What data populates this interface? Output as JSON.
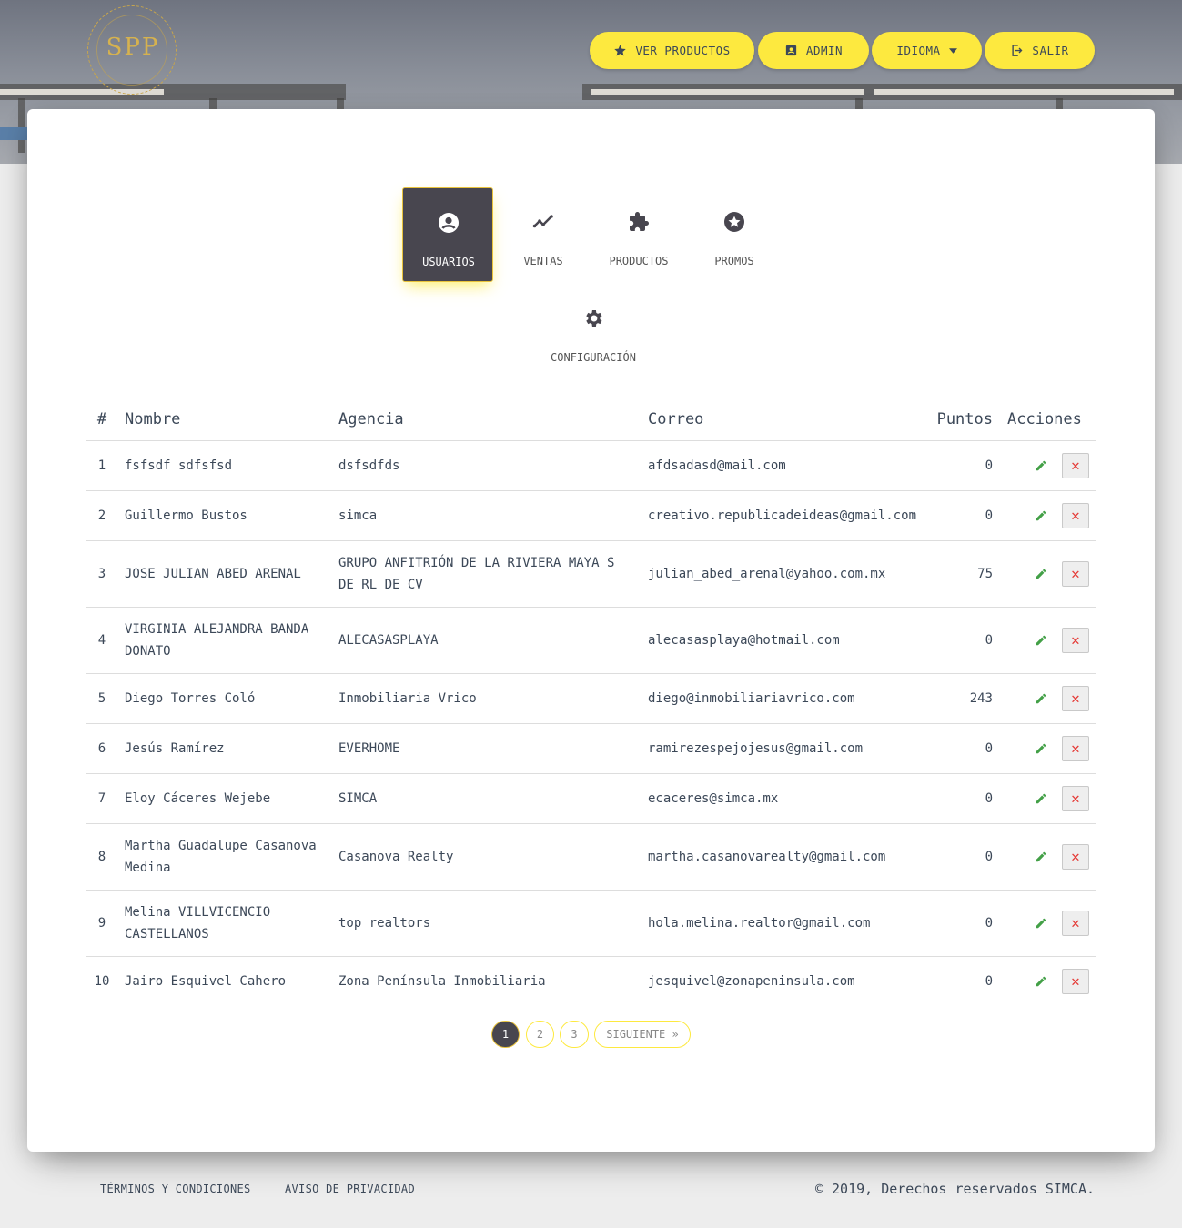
{
  "header": {
    "logo_text": "SPP",
    "logo_ring_text": "SIMCA PARTNERS PROGRAM",
    "nav": [
      {
        "label": "VER PRODUCTOS",
        "icon": "star-icon"
      },
      {
        "label": "ADMIN",
        "icon": "id-card-icon"
      },
      {
        "label": "IDIOMA",
        "icon": "caret-down-icon"
      },
      {
        "label": "SALIR",
        "icon": "exit-icon"
      }
    ]
  },
  "tabs": [
    {
      "label": "USUARIOS",
      "icon": "user-circle-icon",
      "active": true
    },
    {
      "label": "VENTAS",
      "icon": "trend-line-icon",
      "active": false
    },
    {
      "label": "PRODUCTOS",
      "icon": "puzzle-icon",
      "active": false
    },
    {
      "label": "PROMOS",
      "icon": "star-circle-icon",
      "active": false
    },
    {
      "label": "CONFIGURACIÓN",
      "icon": "gear-icon",
      "active": false
    }
  ],
  "table": {
    "headers": [
      "#",
      "Nombre",
      "Agencia",
      "Correo",
      "Puntos",
      "Acciones"
    ],
    "rows": [
      {
        "num": "1",
        "nombre": "fsfsdf sdfsfsd",
        "agencia": "dsfsdfds",
        "correo": "afdsadasd@mail.com",
        "puntos": "0"
      },
      {
        "num": "2",
        "nombre": "Guillermo Bustos",
        "agencia": "simca",
        "correo": "creativo.republicadeideas@gmail.com",
        "puntos": "0"
      },
      {
        "num": "3",
        "nombre": "JOSE JULIAN ABED ARENAL",
        "agencia": "GRUPO ANFITRIÓN DE LA RIVIERA MAYA S DE RL DE CV",
        "correo": "julian_abed_arenal@yahoo.com.mx",
        "puntos": "75"
      },
      {
        "num": "4",
        "nombre": "VIRGINIA ALEJANDRA BANDA DONATO",
        "agencia": "ALECASASPLAYA",
        "correo": "alecasasplaya@hotmail.com",
        "puntos": "0"
      },
      {
        "num": "5",
        "nombre": "Diego Torres Coló",
        "agencia": "Inmobiliaria Vrico",
        "correo": "diego@inmobiliariavrico.com",
        "puntos": "243"
      },
      {
        "num": "6",
        "nombre": "Jesús Ramírez",
        "agencia": "EVERHOME",
        "correo": "ramirezespejojesus@gmail.com",
        "puntos": "0"
      },
      {
        "num": "7",
        "nombre": "Eloy Cáceres Wejebe",
        "agencia": "SIMCA",
        "correo": "ecaceres@simca.mx",
        "puntos": "0"
      },
      {
        "num": "8",
        "nombre": "Martha Guadalupe Casanova Medina",
        "agencia": "Casanova Realty",
        "correo": "martha.casanovarealty@gmail.com",
        "puntos": "0"
      },
      {
        "num": "9",
        "nombre": "Melina VILLVICENCIO CASTELLANOS",
        "agencia": "top realtors",
        "correo": "hola.melina.realtor@gmail.com",
        "puntos": "0"
      },
      {
        "num": "10",
        "nombre": "Jairo Esquivel Cahero",
        "agencia": "Zona Península Inmobiliaria",
        "correo": "jesquivel@zonapeninsula.com",
        "puntos": "0"
      }
    ],
    "delete_glyph": "✕"
  },
  "pagination": {
    "pages": [
      "1",
      "2",
      "3"
    ],
    "current": "1",
    "next_label": "SIGUIENTE »"
  },
  "footer": {
    "links": [
      "TÉRMINOS Y CONDICIONES",
      "AVISO DE PRIVACIDAD"
    ],
    "copyright": "© 2019, Derechos reservados SIMCA."
  },
  "colors": {
    "accent": "#fde93f",
    "dark": "#48464f",
    "edit": "#43a047",
    "delete": "#e53935"
  }
}
